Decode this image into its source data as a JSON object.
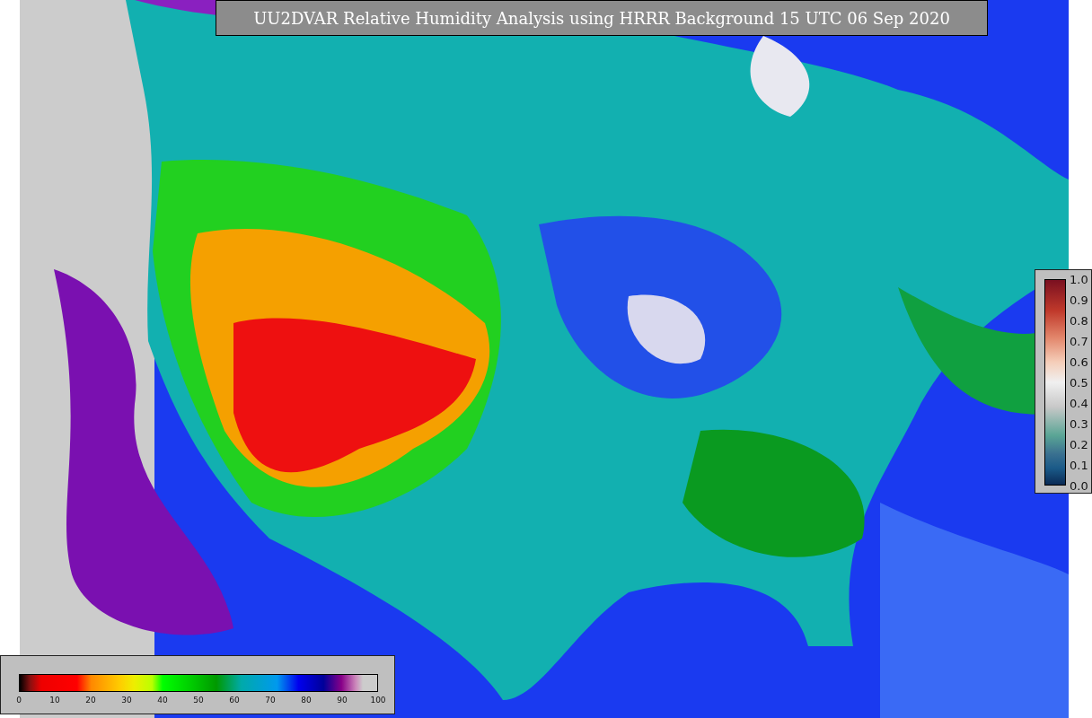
{
  "title": "UU2DVAR Relative Humidity Analysis using HRRR Background 15 UTC 06 Sep 2020",
  "humidity_colorbar": {
    "ticks": [
      "0",
      "10",
      "20",
      "30",
      "40",
      "50",
      "60",
      "70",
      "80",
      "90",
      "100"
    ]
  },
  "observation_colorbar": {
    "ticks": [
      "1.0",
      "0.9",
      "0.8",
      "0.7",
      "0.6",
      "0.5",
      "0.4",
      "0.3",
      "0.2",
      "0.1",
      "0.0"
    ]
  }
}
